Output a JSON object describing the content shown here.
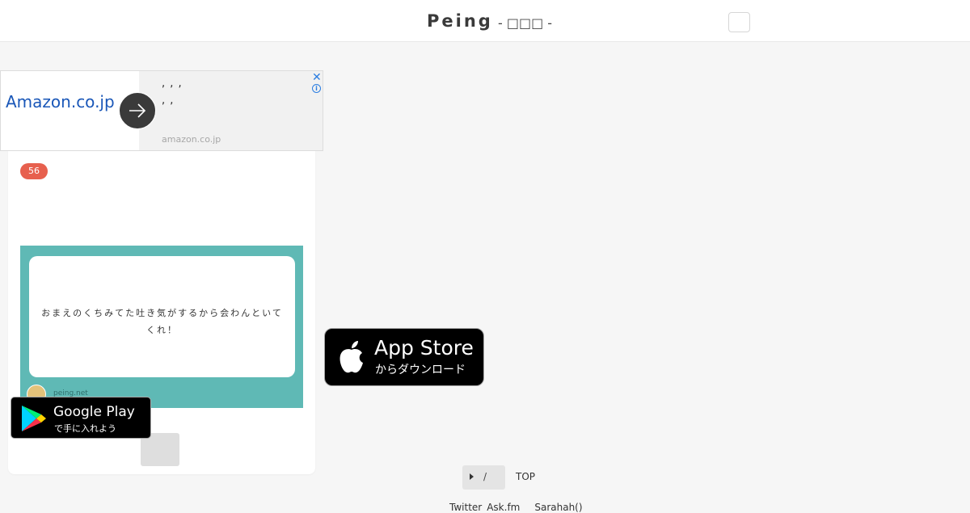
{
  "header": {
    "brand": "Peing",
    "subtitle": "- □□□ -"
  },
  "ad": {
    "brand": "Amazon.co.jp",
    "line1": ", , ,",
    "line2": ", ,",
    "domain": "amazon.co.jp",
    "close_label": "✕",
    "info_label": "i",
    "arrow_icon": "arrow-right-icon"
  },
  "card": {
    "badge_count": "56",
    "question_text": "おまえのくちみてた吐き気がするから会わんといてくれ！",
    "site_label": "peing.net"
  },
  "badges": {
    "google_play": {
      "main": "Google Play",
      "sub": "で手に入れよう"
    },
    "app_store": {
      "main": "App Store",
      "sub": "からダウンロード"
    }
  },
  "footer": {
    "language_value": "/",
    "top_link": "TOP",
    "links": [
      "Twitter",
      "Ask.fm",
      "Sarahah()"
    ]
  },
  "colors": {
    "accent_badge": "#e7604e",
    "question_bg": "#5fb9b5",
    "ad_link": "#1a57b8"
  }
}
